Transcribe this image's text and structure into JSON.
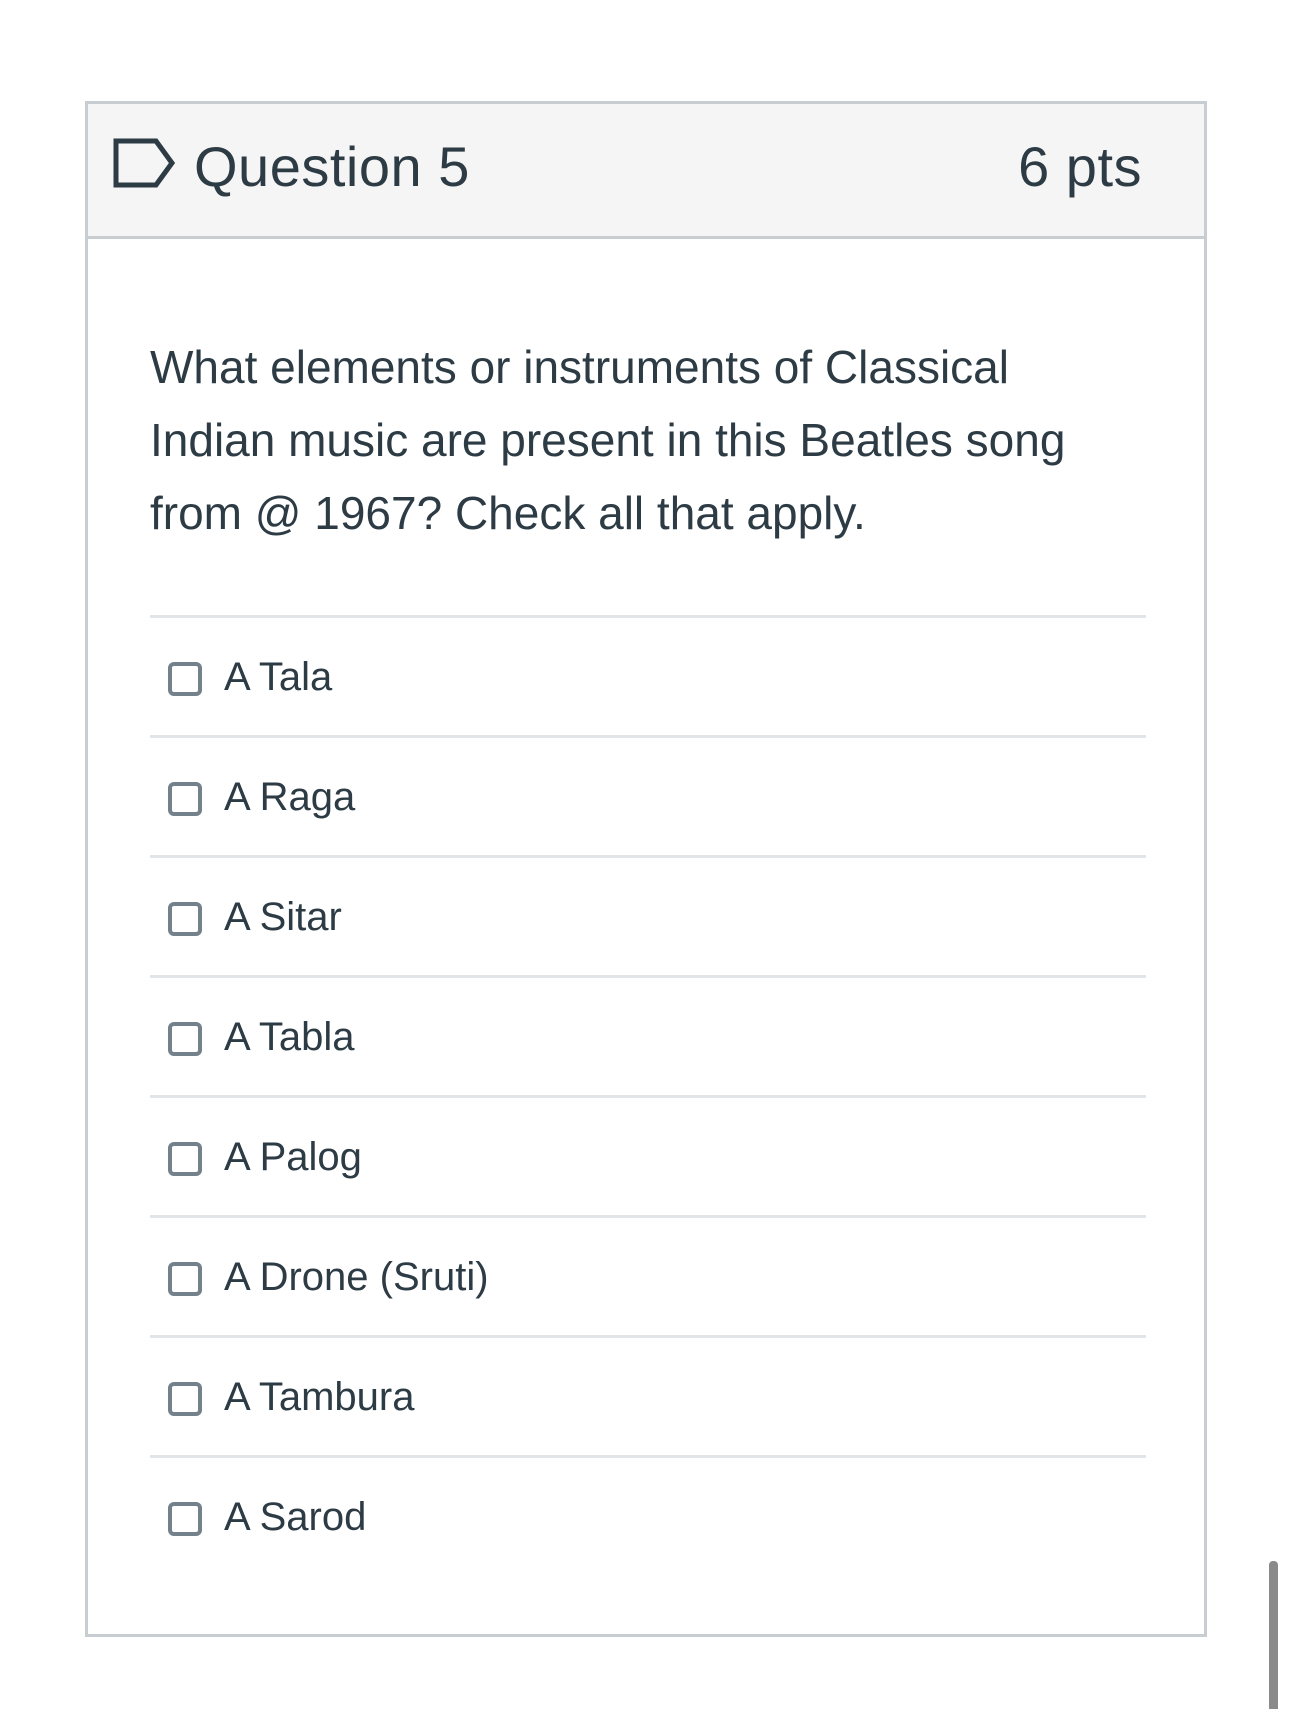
{
  "question": {
    "title": "Question 5",
    "points": "6 pts",
    "flag_icon": "flag-outline-icon",
    "text": "What elements or instruments of Classical Indian music are present in this Beatles song from @ 1967? Check all that apply."
  },
  "answers": [
    {
      "label": "A Tala",
      "checked": false
    },
    {
      "label": "A Raga",
      "checked": false
    },
    {
      "label": "A Sitar",
      "checked": false
    },
    {
      "label": "A Tabla",
      "checked": false
    },
    {
      "label": "A Palog",
      "checked": false
    },
    {
      "label": "A Drone (Sruti)",
      "checked": false
    },
    {
      "label": "A Tambura",
      "checked": false
    },
    {
      "label": "A Sarod",
      "checked": false
    }
  ],
  "colors": {
    "text": "#2d3b45",
    "border": "#c7cdd1",
    "header_bg": "#f5f5f5",
    "divider": "#e2e5e7",
    "checkbox_border": "#73818b"
  }
}
